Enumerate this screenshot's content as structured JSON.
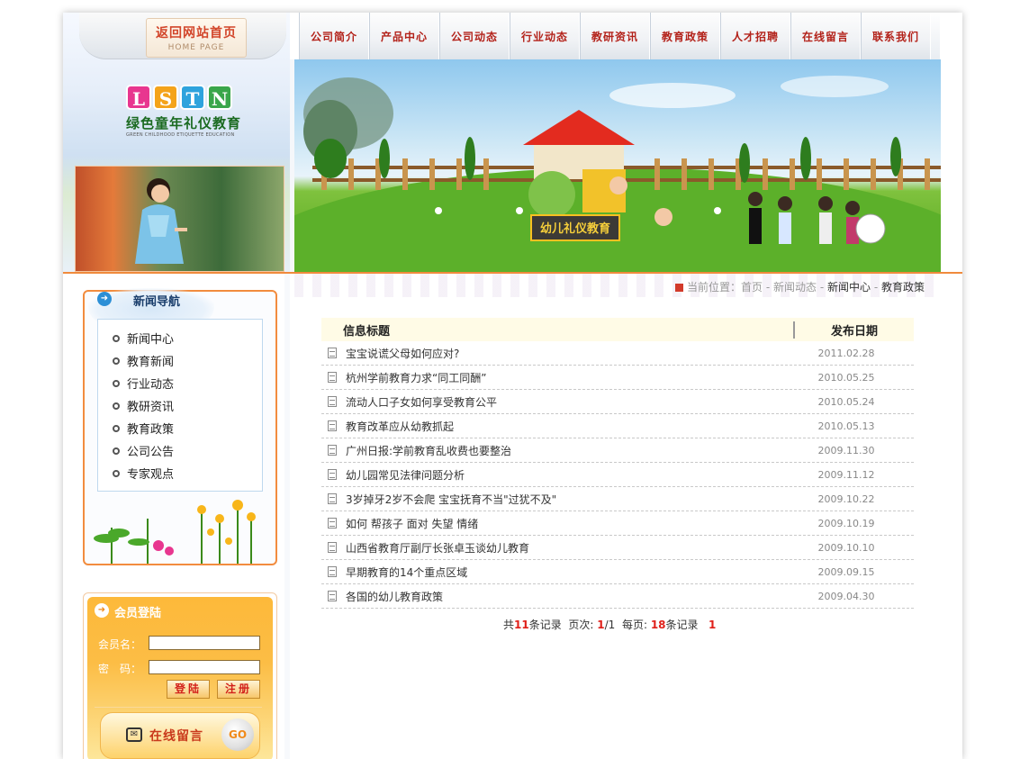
{
  "header": {
    "home_button": {
      "cn": "返回网站首页",
      "en": "HOME PAGE"
    },
    "logo": {
      "letters": [
        "L",
        "S",
        "T",
        "N"
      ],
      "letter_colors": [
        "#e8368f",
        "#f4a31a",
        "#2ea3dd",
        "#3aa64a"
      ],
      "cn": "绿色童年礼仪教育",
      "en": "GREEN CHILDHOOD ETIQUETTE EDUCATION"
    },
    "banner_text": "幼儿礼仪教育"
  },
  "nav": {
    "items": [
      "公司简介",
      "产品中心",
      "公司动态",
      "行业动态",
      "教研资讯",
      "教育政策",
      "人才招聘",
      "在线留言",
      "联系我们"
    ]
  },
  "sidebar": {
    "news_nav": {
      "title": "新闻导航",
      "items": [
        "新闻中心",
        "教育新闻",
        "行业动态",
        "教研资讯",
        "教育政策",
        "公司公告",
        "专家观点"
      ]
    },
    "login": {
      "title": "会员登陆",
      "username_label": "会员名：",
      "password_label": "密　码：",
      "login_button": "登陆",
      "register_button": "注册",
      "message_text": "在线留言",
      "go_text": "GO"
    }
  },
  "breadcrumb": {
    "prefix": "当前位置：",
    "items": [
      "首页",
      "新闻动态",
      "新闻中心",
      "教育政策"
    ],
    "separator": " - "
  },
  "table": {
    "header_title": "信息标题",
    "header_date": "发布日期",
    "rows": [
      {
        "title": "宝宝说谎父母如何应对?",
        "date": "2011.02.28"
      },
      {
        "title": "杭州学前教育力求“同工同酬”",
        "date": "2010.05.25"
      },
      {
        "title": "流动人口子女如何享受教育公平",
        "date": "2010.05.24"
      },
      {
        "title": "教育改革应从幼教抓起",
        "date": "2010.05.13"
      },
      {
        "title": "广州日报:学前教育乱收费也要整治",
        "date": "2009.11.30"
      },
      {
        "title": "幼儿园常见法律问题分析",
        "date": "2009.11.12"
      },
      {
        "title": "3岁掉牙2岁不会爬 宝宝抚育不当\"过犹不及\"",
        "date": "2009.10.22"
      },
      {
        "title": "如何 帮孩子 面对 失望 情绪",
        "date": "2009.10.19"
      },
      {
        "title": "山西省教育厅副厅长张卓玉谈幼儿教育",
        "date": "2009.10.10"
      },
      {
        "title": "早期教育的14个重点区域",
        "date": "2009.09.15"
      },
      {
        "title": "各国的幼儿教育政策",
        "date": "2009.04.30"
      }
    ]
  },
  "pager": {
    "total_prefix": "共",
    "total": "11",
    "total_suffix": "条记录",
    "page_label": "页次:",
    "page_current": "1",
    "page_total": "/1",
    "per_page_label": "每页:",
    "per_page": "18",
    "per_page_suffix": "条记录",
    "page_link": "1"
  },
  "colors": {
    "accent": "#f08a3c",
    "nav_text": "#b3221a",
    "pager_red": "#e0201a"
  }
}
